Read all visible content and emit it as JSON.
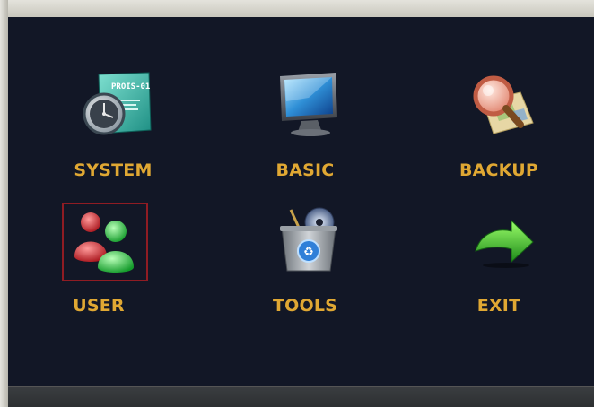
{
  "menu": {
    "items": [
      {
        "id": "system",
        "label": "SYSTEM",
        "icon": "clock-panel-icon",
        "selected": false,
        "panel_text": "PROIS-01"
      },
      {
        "id": "basic",
        "label": "BASIC",
        "icon": "monitor-icon",
        "selected": false
      },
      {
        "id": "backup",
        "label": "BACKUP",
        "icon": "magnifier-map-icon",
        "selected": false
      },
      {
        "id": "user",
        "label": "USER",
        "icon": "users-icon",
        "selected": true
      },
      {
        "id": "tools",
        "label": "TOOLS",
        "icon": "tools-bin-icon",
        "selected": false
      },
      {
        "id": "exit",
        "label": "EXIT",
        "icon": "green-arrow-icon",
        "selected": false
      }
    ]
  },
  "colors": {
    "panel_background": "#121726",
    "label": "#e0a833",
    "selection_border": "#8f1c23"
  }
}
